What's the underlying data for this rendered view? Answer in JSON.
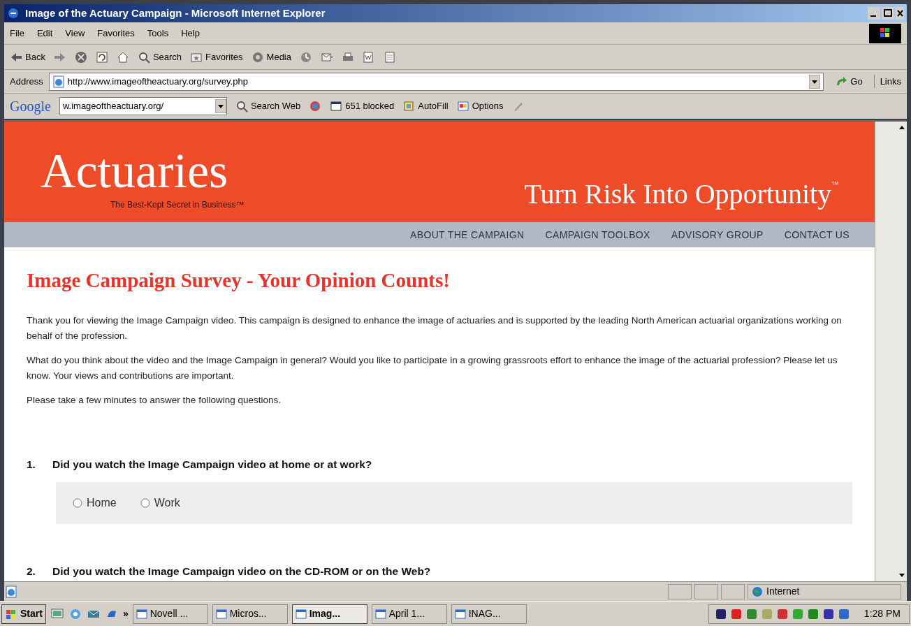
{
  "window": {
    "title": "Image of the Actuary Campaign - Microsoft Internet Explorer"
  },
  "menu": [
    "File",
    "Edit",
    "View",
    "Favorites",
    "Tools",
    "Help"
  ],
  "toolbar": [
    {
      "kind": "back",
      "label": "Back"
    },
    {
      "kind": "forward"
    },
    {
      "kind": "stop"
    },
    {
      "kind": "refresh"
    },
    {
      "kind": "home"
    },
    {
      "kind": "search",
      "label": "Search"
    },
    {
      "kind": "favorites",
      "label": "Favorites"
    },
    {
      "kind": "media",
      "label": "Media"
    },
    {
      "kind": "history"
    },
    {
      "kind": "mail"
    },
    {
      "kind": "print"
    },
    {
      "kind": "edit"
    },
    {
      "kind": "discuss"
    }
  ],
  "address": {
    "label": "Address",
    "value": "http://www.imageoftheactuary.org/survey.php",
    "go": "Go",
    "links": "Links"
  },
  "google_bar": {
    "brand": "Google",
    "field": "w.imageoftheactuary.org/",
    "buttons": [
      {
        "kind": "search",
        "label": "Search Web"
      },
      {
        "kind": "news"
      },
      {
        "kind": "popup",
        "label": "651 blocked"
      },
      {
        "kind": "autofill",
        "label": "AutoFill"
      },
      {
        "kind": "options",
        "label": "Options"
      },
      {
        "kind": "highlight"
      }
    ]
  },
  "page": {
    "logo": "Actuaries",
    "tagline": "The Best-Kept Secret in Business™",
    "slogan": "Turn Risk Into Opportunity",
    "slogan_mark": "™",
    "nav": [
      "ABOUT THE CAMPAIGN",
      "CAMPAIGN TOOLBOX",
      "ADVISORY GROUP",
      "CONTACT US"
    ],
    "heading": "Image Campaign Survey - Your Opinion Counts!",
    "paragraphs": [
      "Thank you for viewing the Image Campaign video. This campaign is designed to enhance the image of actuaries and is supported by the leading North American actuarial organizations working on behalf of the profession.",
      "What do you think about the video and the Image Campaign in general? Would you like to participate in a growing grassroots effort to enhance the image of the actuarial profession? Please let us know. Your views and contributions are important.",
      "Please take a few minutes to answer the following questions."
    ],
    "questions": [
      {
        "number": "1.",
        "text": "Did you watch the Image Campaign video at home or at work?",
        "options": [
          {
            "label": "Home",
            "selected": false
          },
          {
            "label": "Work",
            "selected": false
          }
        ]
      },
      {
        "number": "2.",
        "text": "Did you watch the Image Campaign video on the CD-ROM or on the Web?"
      }
    ]
  },
  "status_bar": {
    "zone": "Internet"
  },
  "taskbar": {
    "start": "Start",
    "quick_launch": [
      {
        "kind": "desktop"
      },
      {
        "kind": "ie-browser"
      },
      {
        "kind": "mail"
      },
      {
        "kind": "media"
      }
    ],
    "more": "»",
    "tasks": [
      {
        "label": "Novell ...",
        "selected": false
      },
      {
        "label": "Micros...",
        "selected": false
      },
      {
        "label": "Imag...",
        "selected": true
      },
      {
        "label": "April 1...",
        "selected": false
      },
      {
        "label": "INAG...",
        "selected": false
      }
    ],
    "clock": "1:28 PM"
  }
}
